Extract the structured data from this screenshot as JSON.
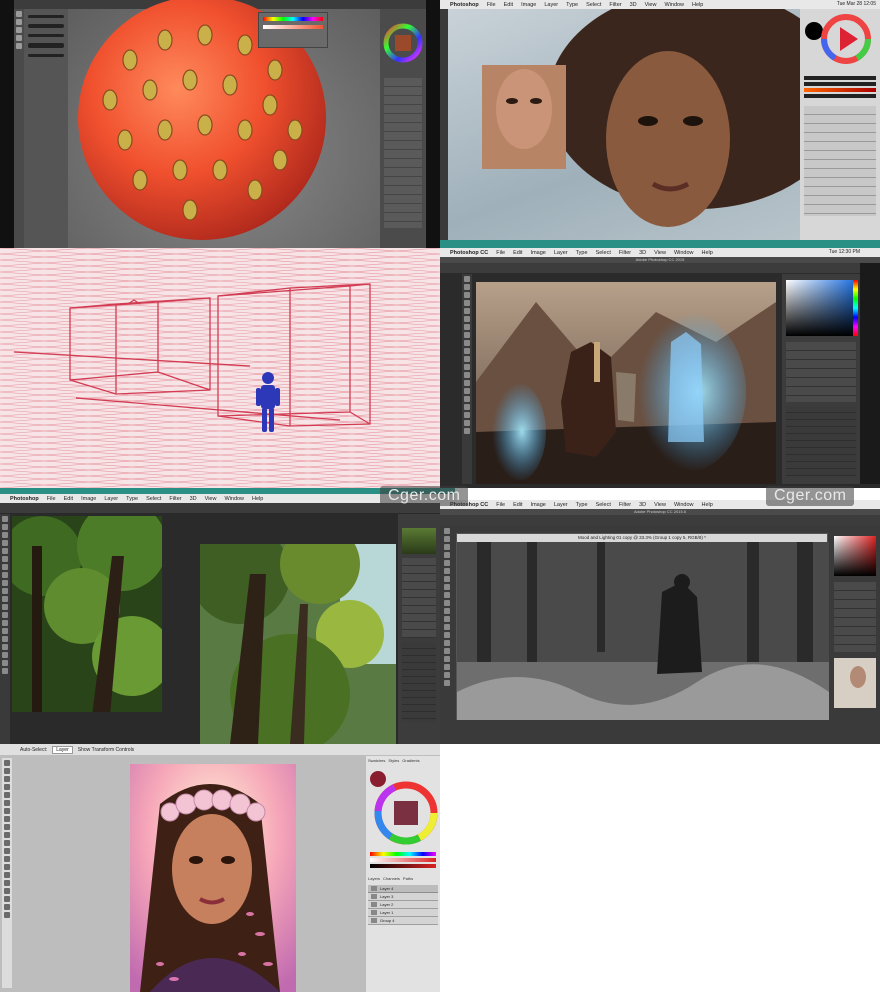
{
  "tiles": {
    "t2": {
      "menu": [
        "Photoshop",
        "File",
        "Edit",
        "Image",
        "Layer",
        "Type",
        "Select",
        "Filter",
        "3D",
        "View",
        "Window",
        "Help"
      ],
      "timestamp": "Tue Mar 28 12:05"
    },
    "t4": {
      "menu": [
        "Photoshop CC",
        "File",
        "Edit",
        "Image",
        "Layer",
        "Type",
        "Select",
        "Filter",
        "3D",
        "View",
        "Window",
        "Help"
      ],
      "time": "Tue 12:30 PM",
      "app_title": "Adobe Photoshop CC 2015"
    },
    "t5": {
      "menu": [
        "Photoshop",
        "File",
        "Edit",
        "Image",
        "Layer",
        "Type",
        "Select",
        "Filter",
        "3D",
        "View",
        "Window",
        "Help"
      ]
    },
    "t6": {
      "menu": [
        "Photoshop CC",
        "File",
        "Edit",
        "Image",
        "Layer",
        "Type",
        "Select",
        "Filter",
        "3D",
        "View",
        "Window",
        "Help"
      ],
      "app_title": "Adobe Photoshop CC 2015.5",
      "doc_title": "Mood and Lighting 01 copy @ 33.3% (Group 1 copy 5, RGB/8) *"
    },
    "t7": {
      "opt_auto_select": "Auto-Select:",
      "opt_layer": "Layer",
      "opt_transform": "Show Transform Controls",
      "panel_tabs": [
        "Swatches",
        "Styles",
        "Gradients"
      ],
      "layers_tabs": [
        "Layers",
        "Channels",
        "Paths"
      ],
      "layers": [
        "Layer 4",
        "Layer 3",
        "Layer 2",
        "Layer 1",
        "Group 4"
      ]
    }
  },
  "watermarks": [
    "Cger.com",
    "Cger.com"
  ],
  "colors": {
    "grid_line": "#e47b8a",
    "box_line": "#d23b52",
    "figure": "#2d38b8",
    "ps_dark": "#2b2b2b",
    "ps_mid": "#3a3a3a",
    "teal_bar": "#5fb3a6"
  }
}
